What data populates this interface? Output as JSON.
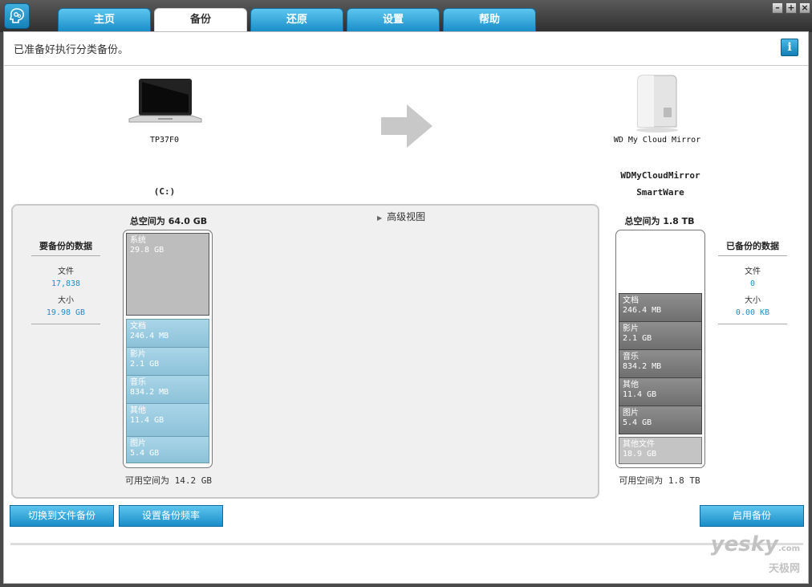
{
  "tabs": [
    {
      "label": "主页"
    },
    {
      "label": "备份"
    },
    {
      "label": "还原"
    },
    {
      "label": "设置"
    },
    {
      "label": "帮助"
    }
  ],
  "status": {
    "text": "已准备好执行分类备份。",
    "info_icon": "i"
  },
  "source": {
    "device_name": "TP37F0",
    "drive": "(C:)"
  },
  "target": {
    "device_name": "WD My Cloud Mirror",
    "share_name": "WDMyCloudMirror",
    "folder": "SmartWare"
  },
  "advanced_view": "高级视图",
  "left_stats": {
    "title": "要备份的数据",
    "files_label": "文件",
    "files_value": "17,838",
    "size_label": "大小",
    "size_value": "19.98 GB"
  },
  "right_stats": {
    "title": "已备份的数据",
    "files_label": "文件",
    "files_value": "0",
    "size_label": "大小",
    "size_value": "0.00 KB"
  },
  "source_bar": {
    "total": "总空间为 64.0 GB",
    "free": "可用空间为 14.2 GB",
    "segments": [
      {
        "name": "系统",
        "size": "29.8 GB"
      },
      {
        "name": "文档",
        "size": "246.4 MB"
      },
      {
        "name": "影片",
        "size": "2.1 GB"
      },
      {
        "name": "音乐",
        "size": "834.2 MB"
      },
      {
        "name": "其他",
        "size": "11.4 GB"
      },
      {
        "name": "图片",
        "size": "5.4 GB"
      }
    ]
  },
  "target_bar": {
    "total": "总空间为 1.8 TB",
    "free": "可用空间为 1.8 TB",
    "segments": [
      {
        "name": "文档",
        "size": "246.4 MB"
      },
      {
        "name": "影片",
        "size": "2.1 GB"
      },
      {
        "name": "音乐",
        "size": "834.2 MB"
      },
      {
        "name": "其他",
        "size": "11.4 GB"
      },
      {
        "name": "图片",
        "size": "5.4 GB"
      },
      {
        "name": "其他文件",
        "size": "18.9 GB"
      }
    ]
  },
  "buttons": {
    "switch_file_backup": "切换到文件备份",
    "set_frequency": "设置备份频率",
    "start_backup": "启用备份"
  },
  "watermark": {
    "line1": "yesky",
    "line2": "天极网",
    "domain": ".com"
  },
  "colors": {
    "accent": "#1a8dc8",
    "value_blue": "#1e8fc7"
  }
}
